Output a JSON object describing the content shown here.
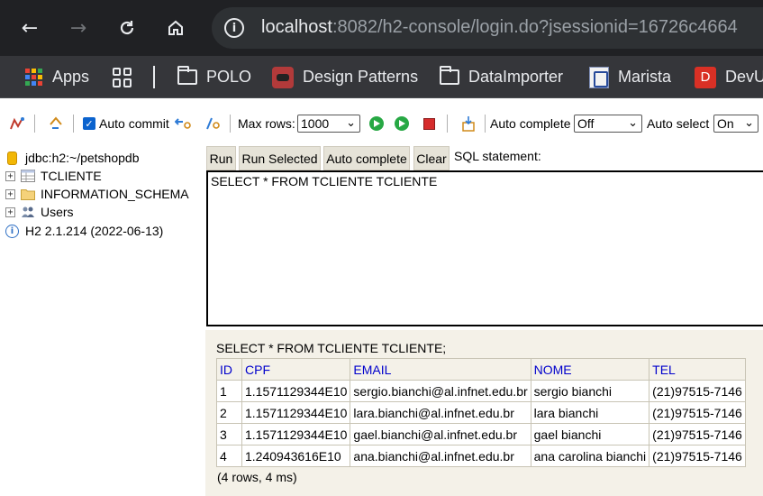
{
  "browser": {
    "url_host": "localhost",
    "url_rest": ":8082/h2-console/login.do?jsessionid=16726c4664",
    "bookmarks": [
      {
        "label": "Apps",
        "icon": "apps-grid-icon"
      },
      {
        "label": "",
        "icon": "grid-icon"
      },
      {
        "label": "POLO",
        "icon": "folder-icon"
      },
      {
        "label": "Design Patterns",
        "icon": "raccoon-favicon"
      },
      {
        "label": "DataImporter",
        "icon": "folder-icon"
      },
      {
        "label": "Marista",
        "icon": "marista-favicon"
      },
      {
        "label": "DevU",
        "icon": "d-favicon"
      }
    ],
    "dev_favicon_letter": "D"
  },
  "toolbar": {
    "auto_commit_label": "Auto commit",
    "max_rows_label": "Max rows:",
    "max_rows_value": "1000",
    "auto_complete_label": "Auto complete",
    "auto_complete_value": "Off",
    "auto_select_label": "Auto select",
    "auto_select_value": "On"
  },
  "tree": {
    "connection": "jdbc:h2:~/petshopdb",
    "items": [
      {
        "label": "TCLIENTE",
        "icon": "table-icon"
      },
      {
        "label": "INFORMATION_SCHEMA",
        "icon": "folder-icon"
      },
      {
        "label": "Users",
        "icon": "users-icon"
      }
    ],
    "version": "H2 2.1.214 (2022-06-13)"
  },
  "query": {
    "buttons": [
      "Run",
      "Run Selected",
      "Auto complete",
      "Clear"
    ],
    "sql_label": "SQL statement:",
    "sql_text": "SELECT * FROM TCLIENTE TCLIENTE"
  },
  "results": {
    "query_echo": "SELECT * FROM TCLIENTE TCLIENTE;",
    "columns": [
      "ID",
      "CPF",
      "EMAIL",
      "NOME",
      "TEL"
    ],
    "rows": [
      [
        "1",
        "1.1571129344E10",
        "sergio.bianchi@al.infnet.edu.br",
        "sergio bianchi",
        "(21)97515-7146"
      ],
      [
        "2",
        "1.1571129344E10",
        "lara.bianchi@al.infnet.edu.br",
        "lara bianchi",
        "(21)97515-7146"
      ],
      [
        "3",
        "1.1571129344E10",
        "gael.bianchi@al.infnet.edu.br",
        "gael bianchi",
        "(21)97515-7146"
      ],
      [
        "4",
        "1.240943616E10",
        "ana.bianchi@al.infnet.edu.br",
        "ana carolina bianchi",
        "(21)97515-7146"
      ]
    ],
    "summary": "(4 rows, 4 ms)"
  }
}
